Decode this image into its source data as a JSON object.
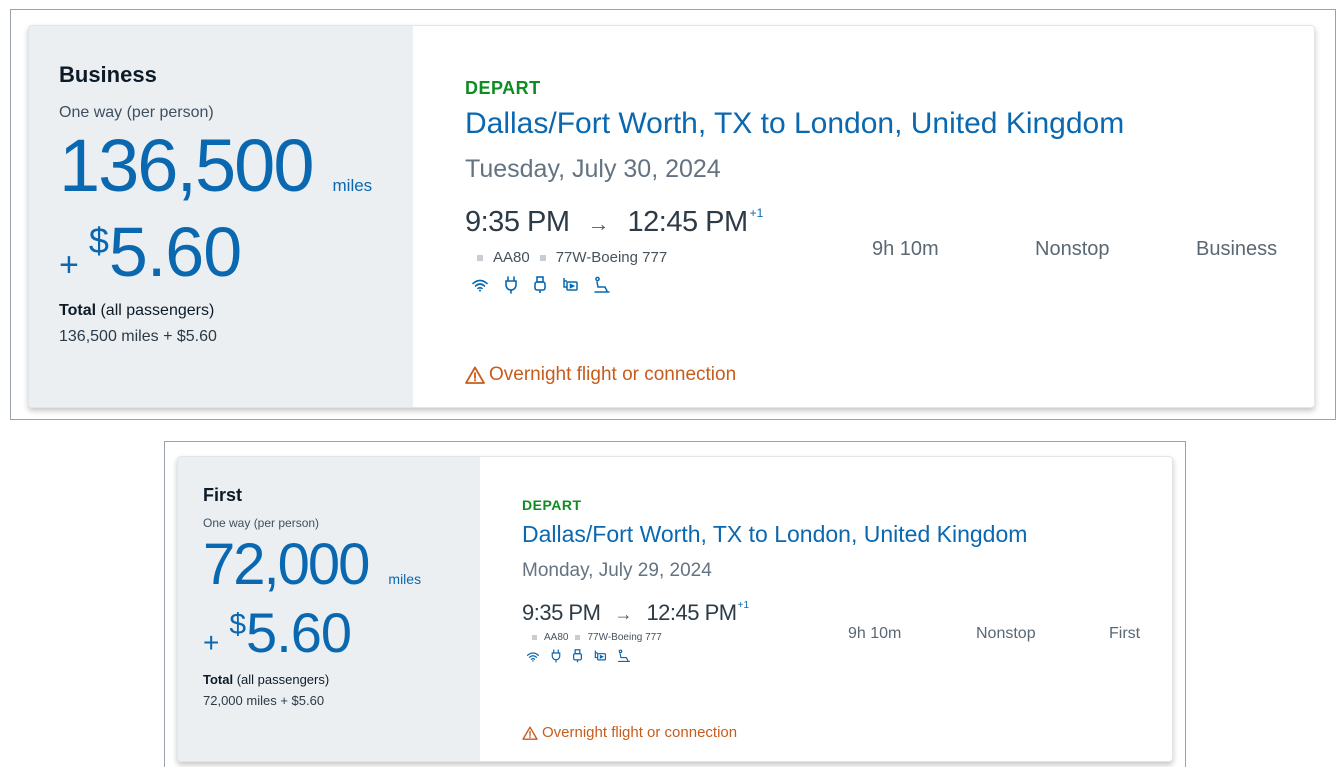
{
  "cards": [
    {
      "cabin": "Business",
      "per_person": "One way (per person)",
      "miles": "136,500",
      "miles_unit": "miles",
      "fee_plus": "+",
      "fee_currency": "$",
      "fee_amount": "5.60",
      "total_label": "Total",
      "total_suffix": " (all passengers)",
      "total_sum": "136,500 miles + $5.60",
      "depart": "DEPART",
      "route": "Dallas/Fort Worth, TX to London, United Kingdom",
      "date": "Tuesday, July 30, 2024",
      "depart_time": "9:35 PM",
      "arrow": "→",
      "arrive_time": "12:45 PM",
      "plus_day": "+1",
      "duration": "9h 10m",
      "stops": "Nonstop",
      "cabin_class": "Business",
      "flight_number": "AA80",
      "aircraft": "77W-Boeing 777",
      "amenities": [
        "wifi-icon",
        "power-outlet-icon",
        "usb-icon",
        "entertainment-icon",
        "lie-flat-seat-icon"
      ],
      "warning": "Overnight flight or connection",
      "colors": {
        "accent": "#0a68b0",
        "depart": "#0e8c22",
        "warning": "#c75c1c",
        "panel": "#eceff2"
      }
    },
    {
      "cabin": "First",
      "per_person": "One way (per person)",
      "miles": "72,000",
      "miles_unit": "miles",
      "fee_plus": "+",
      "fee_currency": "$",
      "fee_amount": "5.60",
      "total_label": "Total",
      "total_suffix": " (all passengers)",
      "total_sum": "72,000 miles + $5.60",
      "depart": "DEPART",
      "route": "Dallas/Fort Worth, TX to London, United Kingdom",
      "date": "Monday, July 29, 2024",
      "depart_time": "9:35 PM",
      "arrow": "→",
      "arrive_time": "12:45 PM",
      "plus_day": "+1",
      "duration": "9h 10m",
      "stops": "Nonstop",
      "cabin_class": "First",
      "flight_number": "AA80",
      "aircraft": "77W-Boeing 777",
      "amenities": [
        "wifi-icon",
        "power-outlet-icon",
        "usb-icon",
        "entertainment-icon",
        "lie-flat-seat-icon"
      ],
      "warning": "Overnight flight or connection",
      "colors": {
        "accent": "#0a68b0",
        "depart": "#0e8c22",
        "warning": "#c75c1c",
        "panel": "#eceff2"
      }
    }
  ]
}
